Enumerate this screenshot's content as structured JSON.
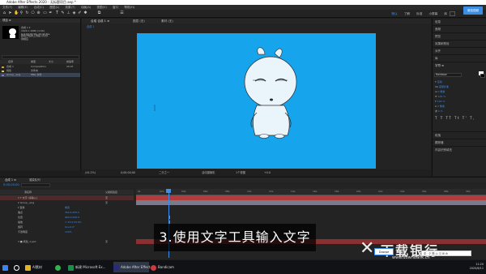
{
  "window": {
    "title": "Adobe After Effects 2020 - 无标题项目.aep *",
    "menu": [
      "文件(F)",
      "编辑(E)",
      "合成(C)",
      "图层(L)",
      "效果(T)",
      "动画(A)",
      "视图(V)",
      "窗口",
      "帮助(H)"
    ],
    "workspaces": [
      "默认",
      "了解",
      "标准",
      "小屏幕",
      "库"
    ],
    "badge": "微信视频"
  },
  "project": {
    "tab_label": "项目 ≡",
    "comp_name": "合成 1 ▾",
    "comp_info": [
      "1920 x 1080 (1.00)",
      "Δ 0;00;30;00, 29.97 fps"
    ],
    "comment": "颜色方框的上例指 (背景)",
    "comment2": "用相应",
    "columns": [
      "名称",
      "类型",
      "大小",
      "帧速率"
    ],
    "items": [
      {
        "name": "合成 1",
        "type": "Composition",
        "size": "",
        "fps": "29.97",
        "color": "#c9a24a"
      },
      {
        "name": "纯色",
        "type": "文件夹",
        "size": "",
        "fps": "",
        "color": "#d6c35a"
      },
      {
        "name": "Group_.png",
        "type": "PNG 文件",
        "size": "",
        "fps": "",
        "color": "#7a7ac9",
        "selected": true
      }
    ],
    "footer": "8 bpc"
  },
  "viewer": {
    "tabs": [
      "合成 合成 1 ≡",
      "图层 (无)",
      "素材 (无)"
    ],
    "comp_tab": "合成 1",
    "canvas_color": "#16a4ec",
    "controls": [
      "(44.2%)",
      "▾",
      "0;00;00;00",
      "二分之一",
      "活动摄像机",
      "1个视图",
      "+0.0"
    ],
    "zoom_label": "44.2%"
  },
  "right": {
    "panels": [
      "信息",
      "音频",
      "预览",
      "效果和预设",
      "对齐",
      "库",
      "字符 ≡"
    ],
    "font_name": "Rainbow",
    "text_values": [
      "自动",
      "度量标准",
      "0 像素",
      "100 %",
      "100 %",
      "0 %",
      "0 像素"
    ],
    "faux": "T T TT Tt T' T,",
    "bottom_panels": [
      "段落",
      "跟踪器",
      "内容识别填充"
    ]
  },
  "timeline": {
    "tabs": [
      "合成 1 ≡",
      "渲染队列"
    ],
    "timecode": "0;00;00;00",
    "columns": [
      "源名称",
      "父级和链接"
    ],
    "layers": [
      {
        "name": "1 T 文字 (请输入)",
        "parent": "无",
        "highlight": "#a03030"
      },
      {
        "name": "2  Group_.png",
        "parent": "无",
        "highlight": "#3a3a3a"
      },
      {
        "name": "  ▾ 变换",
        "parent": "重置"
      },
      {
        "name": "      锚点",
        "parent": "360.5,455.5"
      },
      {
        "name": "      位置",
        "parent": "960.0,540.0"
      },
      {
        "name": "      缩放",
        "parent": "∞ 33.0,33.0%"
      },
      {
        "name": "      旋转",
        "parent": "0x+0.0°"
      },
      {
        "name": "      不透明度",
        "parent": "100%"
      },
      {
        "name": "3  ■ 纯色_1.psd",
        "parent": "无"
      }
    ],
    "ruler": [
      "0s",
      "02s",
      "04s",
      "06s",
      "08s",
      "10s",
      "12s",
      "14s",
      "16s",
      "18s",
      "20s",
      "22s",
      "24s",
      "26s",
      "28s",
      "30s"
    ]
  },
  "caption": "3.使用文字工具输入文字",
  "watermark": {
    "logo": "✕",
    "text": "下载银行",
    "url": "www.downbank.cn",
    "tag": "Dowpe"
  },
  "ime": "中 · ⚲ 简 ◎ ◫ ⊞ ⚙",
  "taskbar": {
    "items": [
      {
        "label": "",
        "color": "#3b82f6"
      },
      {
        "label": "",
        "color": "#ffffff"
      },
      {
        "label": "AI素材",
        "color": "#e6b31e"
      },
      {
        "label": "",
        "color": "#35b34a"
      },
      {
        "label": "新建 Microsoft Ex...",
        "color": "#1f8a4c"
      },
      {
        "label": "Adobe After Effect...",
        "color": "#2a2a7a"
      },
      {
        "label": "Bandicam",
        "color": "#d23a3a"
      }
    ],
    "time": "11:20",
    "date": "2020/6/11"
  }
}
